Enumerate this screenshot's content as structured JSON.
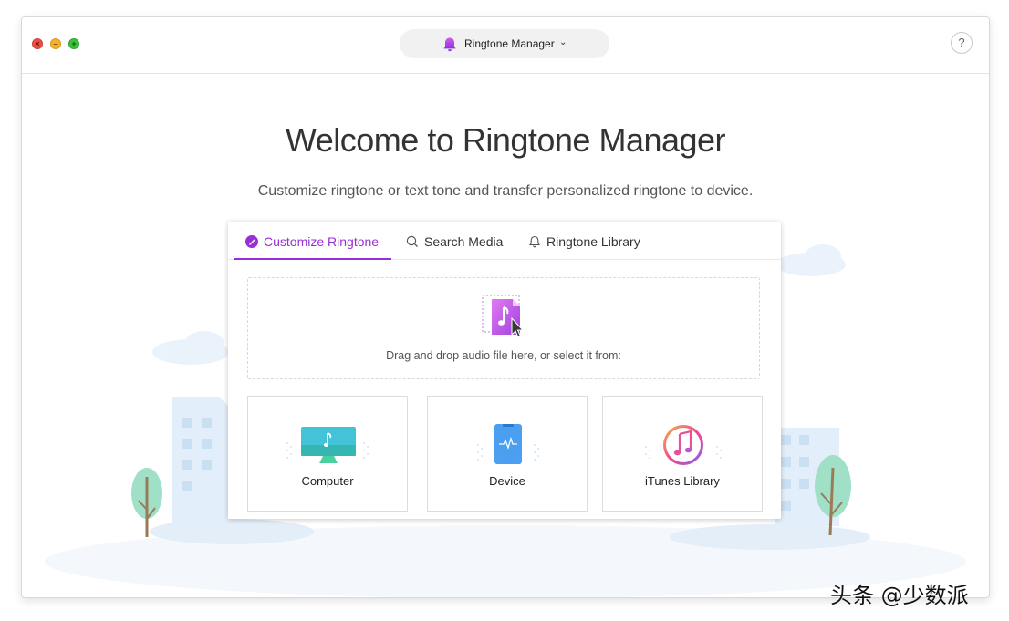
{
  "window": {
    "app_name": "Ringtone Manager",
    "help_label": "?"
  },
  "main": {
    "title": "Welcome to Ringtone Manager",
    "subtitle": "Customize ringtone or text tone and transfer personalized ringtone to device."
  },
  "tabs": [
    {
      "label": "Customize Ringtone",
      "icon": "ringtone-edit-icon",
      "active": true
    },
    {
      "label": "Search Media",
      "icon": "search-icon",
      "active": false
    },
    {
      "label": "Ringtone Library",
      "icon": "bell-icon",
      "active": false
    }
  ],
  "dropzone": {
    "text": "Drag and drop audio file here, or select it from:"
  },
  "sources": [
    {
      "label": "Computer",
      "icon": "computer-icon"
    },
    {
      "label": "Device",
      "icon": "device-icon"
    },
    {
      "label": "iTunes Library",
      "icon": "itunes-icon"
    }
  ],
  "watermark": "头条 @少数派",
  "colors": {
    "accent": "#9a2fd6",
    "close": "#ee4d45",
    "minimize": "#f5b02c",
    "maximize": "#3ec03c"
  }
}
